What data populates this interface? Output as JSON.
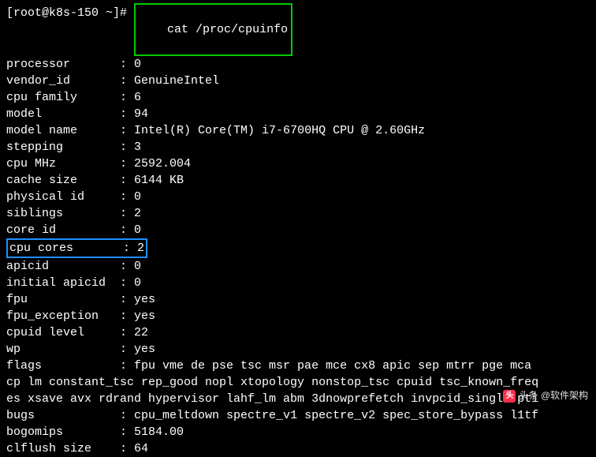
{
  "prompt": "[root@k8s-150 ~]# ",
  "command": "cat /proc/cpuinfo",
  "rows": [
    {
      "k": "processor",
      "v": "0"
    },
    {
      "k": "vendor_id",
      "v": "GenuineIntel"
    },
    {
      "k": "cpu family",
      "v": "6"
    },
    {
      "k": "model",
      "v": "94"
    },
    {
      "k": "model name",
      "v": "Intel(R) Core(TM) i7-6700HQ CPU @ 2.60GHz"
    },
    {
      "k": "stepping",
      "v": "3"
    },
    {
      "k": "cpu MHz",
      "v": "2592.004"
    },
    {
      "k": "cache size",
      "v": "6144 KB"
    },
    {
      "k": "physical id",
      "v": "0"
    },
    {
      "k": "siblings",
      "v": "2"
    },
    {
      "k": "core id",
      "v": "0"
    },
    {
      "k": "cpu cores",
      "v": "2",
      "highlight": true
    },
    {
      "k": "apicid",
      "v": "0"
    },
    {
      "k": "initial apicid",
      "v": "0"
    },
    {
      "k": "fpu",
      "v": "yes"
    },
    {
      "k": "fpu_exception",
      "v": "yes"
    },
    {
      "k": "cpuid level",
      "v": "22"
    },
    {
      "k": "wp",
      "v": "yes"
    }
  ],
  "flags_key": "flags",
  "flags_line1": "flags           : fpu vme de pse tsc msr pae mce cx8 apic sep mtrr pge mca ",
  "flags_line2": "cp lm constant_tsc rep_good nopl xtopology nonstop_tsc cpuid tsc_known_freq",
  "flags_line3": "es xsave avx rdrand hypervisor lahf_lm abm 3dnowprefetch invpcid_single pti",
  "tail": [
    {
      "k": "bugs",
      "v": "cpu_meltdown spectre_v1 spectre_v2 spec_store_bypass l1tf"
    },
    {
      "k": "bogomips",
      "v": "5184.00"
    },
    {
      "k": "clflush size",
      "v": "64"
    }
  ],
  "separator": ": ",
  "watermark": "头条 @软件架构"
}
